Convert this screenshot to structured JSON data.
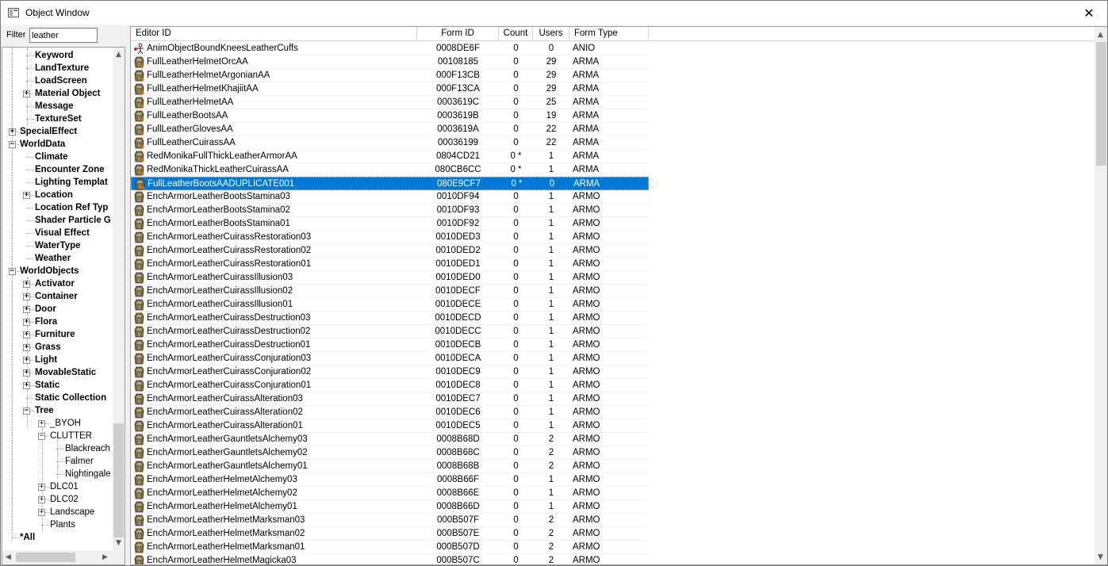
{
  "window": {
    "title": "Object Window",
    "close_glyph": "✕"
  },
  "filter": {
    "label": "Filter",
    "value": "leather"
  },
  "tree": {
    "nodes": [
      {
        "label": "Keyword",
        "level": 2,
        "bold": true,
        "expander": ""
      },
      {
        "label": "LandTexture",
        "level": 2,
        "bold": true,
        "expander": ""
      },
      {
        "label": "LoadScreen",
        "level": 2,
        "bold": true,
        "expander": ""
      },
      {
        "label": "Material Object",
        "level": 2,
        "bold": true,
        "expander": "+"
      },
      {
        "label": "Message",
        "level": 2,
        "bold": true,
        "expander": ""
      },
      {
        "label": "TextureSet",
        "level": 2,
        "bold": true,
        "expander": ""
      },
      {
        "label": "SpecialEffect",
        "level": 1,
        "bold": true,
        "expander": "+"
      },
      {
        "label": "WorldData",
        "level": 1,
        "bold": true,
        "expander": "−"
      },
      {
        "label": "Climate",
        "level": 2,
        "bold": true,
        "expander": ""
      },
      {
        "label": "Encounter Zone",
        "level": 2,
        "bold": true,
        "expander": ""
      },
      {
        "label": "Lighting Templat",
        "level": 2,
        "bold": true,
        "expander": ""
      },
      {
        "label": "Location",
        "level": 2,
        "bold": true,
        "expander": "+"
      },
      {
        "label": "Location Ref Typ",
        "level": 2,
        "bold": true,
        "expander": ""
      },
      {
        "label": "Shader Particle G",
        "level": 2,
        "bold": true,
        "expander": ""
      },
      {
        "label": "Visual Effect",
        "level": 2,
        "bold": true,
        "expander": ""
      },
      {
        "label": "WaterType",
        "level": 2,
        "bold": true,
        "expander": ""
      },
      {
        "label": "Weather",
        "level": 2,
        "bold": true,
        "expander": ""
      },
      {
        "label": "WorldObjects",
        "level": 1,
        "bold": true,
        "expander": "−"
      },
      {
        "label": "Activator",
        "level": 2,
        "bold": true,
        "expander": "+"
      },
      {
        "label": "Container",
        "level": 2,
        "bold": true,
        "expander": "+"
      },
      {
        "label": "Door",
        "level": 2,
        "bold": true,
        "expander": "+"
      },
      {
        "label": "Flora",
        "level": 2,
        "bold": true,
        "expander": "+"
      },
      {
        "label": "Furniture",
        "level": 2,
        "bold": true,
        "expander": "+"
      },
      {
        "label": "Grass",
        "level": 2,
        "bold": true,
        "expander": "+"
      },
      {
        "label": "Light",
        "level": 2,
        "bold": true,
        "expander": "+"
      },
      {
        "label": "MovableStatic",
        "level": 2,
        "bold": true,
        "expander": "+"
      },
      {
        "label": "Static",
        "level": 2,
        "bold": true,
        "expander": "+"
      },
      {
        "label": "Static Collection",
        "level": 2,
        "bold": true,
        "expander": ""
      },
      {
        "label": "Tree",
        "level": 2,
        "bold": true,
        "expander": "−"
      },
      {
        "label": "_BYOH",
        "level": 3,
        "bold": false,
        "expander": "+"
      },
      {
        "label": "CLUTTER",
        "level": 3,
        "bold": false,
        "expander": "−"
      },
      {
        "label": "Blackreach",
        "level": 4,
        "bold": false,
        "expander": ""
      },
      {
        "label": "Falmer",
        "level": 4,
        "bold": false,
        "expander": ""
      },
      {
        "label": "Nightingale",
        "level": 4,
        "bold": false,
        "expander": ""
      },
      {
        "label": "DLC01",
        "level": 3,
        "bold": false,
        "expander": "+"
      },
      {
        "label": "DLC02",
        "level": 3,
        "bold": false,
        "expander": "+"
      },
      {
        "label": "Landscape",
        "level": 3,
        "bold": false,
        "expander": "+"
      },
      {
        "label": "Plants",
        "level": 3,
        "bold": false,
        "expander": ""
      },
      {
        "label": "*All",
        "level": 1,
        "bold": true,
        "expander": ""
      }
    ]
  },
  "list": {
    "columns": [
      {
        "key": "editor_id",
        "label": "Editor ID"
      },
      {
        "key": "form_id",
        "label": "Form ID"
      },
      {
        "key": "count",
        "label": "Count"
      },
      {
        "key": "users",
        "label": "Users"
      },
      {
        "key": "form_type",
        "label": "Form Type"
      }
    ],
    "selected_index": 10,
    "rows": [
      {
        "editor_id": "AnimObjectBoundKneesLeatherCuffs",
        "form_id": "0008DE6F",
        "count": "0",
        "users": "0",
        "form_type": "ANIO",
        "icon": "anim-object-icon"
      },
      {
        "editor_id": "FullLeatherHelmetOrcAA",
        "form_id": "00108185",
        "count": "0",
        "users": "29",
        "form_type": "ARMA",
        "icon": "armor-addon-icon"
      },
      {
        "editor_id": "FullLeatherHelmetArgonianAA",
        "form_id": "000F13CB",
        "count": "0",
        "users": "29",
        "form_type": "ARMA",
        "icon": "armor-addon-icon"
      },
      {
        "editor_id": "FullLeatherHelmetKhajiitAA",
        "form_id": "000F13CA",
        "count": "0",
        "users": "29",
        "form_type": "ARMA",
        "icon": "armor-addon-icon"
      },
      {
        "editor_id": "FullLeatherHelmetAA",
        "form_id": "0003619C",
        "count": "0",
        "users": "25",
        "form_type": "ARMA",
        "icon": "armor-addon-icon"
      },
      {
        "editor_id": "FullLeatherBootsAA",
        "form_id": "0003619B",
        "count": "0",
        "users": "19",
        "form_type": "ARMA",
        "icon": "armor-addon-icon"
      },
      {
        "editor_id": "FullLeatherGlovesAA",
        "form_id": "0003619A",
        "count": "0",
        "users": "22",
        "form_type": "ARMA",
        "icon": "armor-addon-icon"
      },
      {
        "editor_id": "FullLeatherCuirassAA",
        "form_id": "00036199",
        "count": "0",
        "users": "22",
        "form_type": "ARMA",
        "icon": "armor-addon-icon"
      },
      {
        "editor_id": "RedMonikaFullThickLeatherArmorAA",
        "form_id": "0804CD21",
        "count": "0 *",
        "users": "1",
        "form_type": "ARMA",
        "icon": "armor-addon-icon"
      },
      {
        "editor_id": "RedMonikaThickLeatherCuirassAA",
        "form_id": "080CB6CC",
        "count": "0 *",
        "users": "1",
        "form_type": "ARMA",
        "icon": "armor-addon-icon"
      },
      {
        "editor_id": "FullLeatherBootsAADUPLICATE001",
        "form_id": "080E9CF7",
        "count": "0 *",
        "users": "0",
        "form_type": "ARMA",
        "icon": "armor-addon-icon"
      },
      {
        "editor_id": "EnchArmorLeatherBootsStamina03",
        "form_id": "0010DF94",
        "count": "0",
        "users": "1",
        "form_type": "ARMO",
        "icon": "armor-icon"
      },
      {
        "editor_id": "EnchArmorLeatherBootsStamina02",
        "form_id": "0010DF93",
        "count": "0",
        "users": "1",
        "form_type": "ARMO",
        "icon": "armor-icon"
      },
      {
        "editor_id": "EnchArmorLeatherBootsStamina01",
        "form_id": "0010DF92",
        "count": "0",
        "users": "1",
        "form_type": "ARMO",
        "icon": "armor-icon"
      },
      {
        "editor_id": "EnchArmorLeatherCuirassRestoration03",
        "form_id": "0010DED3",
        "count": "0",
        "users": "1",
        "form_type": "ARMO",
        "icon": "armor-icon"
      },
      {
        "editor_id": "EnchArmorLeatherCuirassRestoration02",
        "form_id": "0010DED2",
        "count": "0",
        "users": "1",
        "form_type": "ARMO",
        "icon": "armor-icon"
      },
      {
        "editor_id": "EnchArmorLeatherCuirassRestoration01",
        "form_id": "0010DED1",
        "count": "0",
        "users": "1",
        "form_type": "ARMO",
        "icon": "armor-icon"
      },
      {
        "editor_id": "EnchArmorLeatherCuirassIllusion03",
        "form_id": "0010DED0",
        "count": "0",
        "users": "1",
        "form_type": "ARMO",
        "icon": "armor-icon"
      },
      {
        "editor_id": "EnchArmorLeatherCuirassIllusion02",
        "form_id": "0010DECF",
        "count": "0",
        "users": "1",
        "form_type": "ARMO",
        "icon": "armor-icon"
      },
      {
        "editor_id": "EnchArmorLeatherCuirassIllusion01",
        "form_id": "0010DECE",
        "count": "0",
        "users": "1",
        "form_type": "ARMO",
        "icon": "armor-icon"
      },
      {
        "editor_id": "EnchArmorLeatherCuirassDestruction03",
        "form_id": "0010DECD",
        "count": "0",
        "users": "1",
        "form_type": "ARMO",
        "icon": "armor-icon"
      },
      {
        "editor_id": "EnchArmorLeatherCuirassDestruction02",
        "form_id": "0010DECC",
        "count": "0",
        "users": "1",
        "form_type": "ARMO",
        "icon": "armor-icon"
      },
      {
        "editor_id": "EnchArmorLeatherCuirassDestruction01",
        "form_id": "0010DECB",
        "count": "0",
        "users": "1",
        "form_type": "ARMO",
        "icon": "armor-icon"
      },
      {
        "editor_id": "EnchArmorLeatherCuirassConjuration03",
        "form_id": "0010DECA",
        "count": "0",
        "users": "1",
        "form_type": "ARMO",
        "icon": "armor-icon"
      },
      {
        "editor_id": "EnchArmorLeatherCuirassConjuration02",
        "form_id": "0010DEC9",
        "count": "0",
        "users": "1",
        "form_type": "ARMO",
        "icon": "armor-icon"
      },
      {
        "editor_id": "EnchArmorLeatherCuirassConjuration01",
        "form_id": "0010DEC8",
        "count": "0",
        "users": "1",
        "form_type": "ARMO",
        "icon": "armor-icon"
      },
      {
        "editor_id": "EnchArmorLeatherCuirassAlteration03",
        "form_id": "0010DEC7",
        "count": "0",
        "users": "1",
        "form_type": "ARMO",
        "icon": "armor-icon"
      },
      {
        "editor_id": "EnchArmorLeatherCuirassAlteration02",
        "form_id": "0010DEC6",
        "count": "0",
        "users": "1",
        "form_type": "ARMO",
        "icon": "armor-icon"
      },
      {
        "editor_id": "EnchArmorLeatherCuirassAlteration01",
        "form_id": "0010DEC5",
        "count": "0",
        "users": "1",
        "form_type": "ARMO",
        "icon": "armor-icon"
      },
      {
        "editor_id": "EnchArmorLeatherGauntletsAlchemy03",
        "form_id": "0008B68D",
        "count": "0",
        "users": "2",
        "form_type": "ARMO",
        "icon": "armor-icon"
      },
      {
        "editor_id": "EnchArmorLeatherGauntletsAlchemy02",
        "form_id": "0008B68C",
        "count": "0",
        "users": "2",
        "form_type": "ARMO",
        "icon": "armor-icon"
      },
      {
        "editor_id": "EnchArmorLeatherGauntletsAlchemy01",
        "form_id": "0008B68B",
        "count": "0",
        "users": "2",
        "form_type": "ARMO",
        "icon": "armor-icon"
      },
      {
        "editor_id": "EnchArmorLeatherHelmetAlchemy03",
        "form_id": "0008B66F",
        "count": "0",
        "users": "1",
        "form_type": "ARMO",
        "icon": "armor-icon"
      },
      {
        "editor_id": "EnchArmorLeatherHelmetAlchemy02",
        "form_id": "0008B66E",
        "count": "0",
        "users": "1",
        "form_type": "ARMO",
        "icon": "armor-icon"
      },
      {
        "editor_id": "EnchArmorLeatherHelmetAlchemy01",
        "form_id": "0008B66D",
        "count": "0",
        "users": "1",
        "form_type": "ARMO",
        "icon": "armor-icon"
      },
      {
        "editor_id": "EnchArmorLeatherHelmetMarksman03",
        "form_id": "000B507F",
        "count": "0",
        "users": "2",
        "form_type": "ARMO",
        "icon": "armor-icon"
      },
      {
        "editor_id": "EnchArmorLeatherHelmetMarksman02",
        "form_id": "000B507E",
        "count": "0",
        "users": "2",
        "form_type": "ARMO",
        "icon": "armor-icon"
      },
      {
        "editor_id": "EnchArmorLeatherHelmetMarksman01",
        "form_id": "000B507D",
        "count": "0",
        "users": "2",
        "form_type": "ARMO",
        "icon": "armor-icon"
      },
      {
        "editor_id": "EnchArmorLeatherHelmetMagicka03",
        "form_id": "000B507C",
        "count": "0",
        "users": "2",
        "form_type": "ARMO",
        "icon": "armor-icon"
      }
    ]
  },
  "scroll": {
    "up": "▲",
    "down": "▼",
    "left": "◀",
    "right": "▶"
  },
  "colors": {
    "selection": "#0078d7"
  }
}
